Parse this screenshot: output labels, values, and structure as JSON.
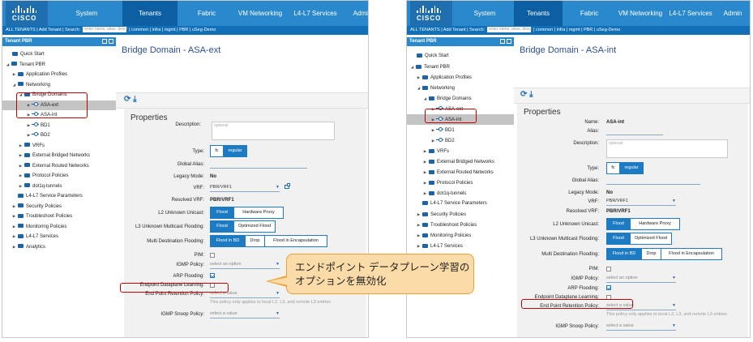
{
  "nav": {
    "logo_text": "CISCO",
    "tabs": [
      "System",
      "Tenants",
      "Fabric",
      "VM Networking",
      "L4-L7 Services",
      "Admin"
    ],
    "active_tab": "Tenants"
  },
  "subnav": {
    "all_tenants": "ALL TENANTS",
    "add_tenant": "Add Tenant",
    "search_label": "Search:",
    "search_placeholder": "enter name, alias, descr",
    "links": [
      "common",
      "infra",
      "mgmt",
      "PBR",
      "uSeg-Demo"
    ]
  },
  "sidebar": {
    "header": "Tenant PBR",
    "items": {
      "quick_start": "Quick Start",
      "tenant": "Tenant PBR",
      "app_profiles": "Application Profiles",
      "networking": "Networking",
      "bridge_domains": "Bridge Domains",
      "asa_ext": "ASA-ext",
      "asa_int": "ASA-int",
      "bd1": "BD1",
      "bd2": "BD2",
      "vrfs": "VRFs",
      "ext_bridged": "External Bridged Networks",
      "ext_routed": "External Routed Networks",
      "protocol_policies": "Protocol Policies",
      "dot1q": "dot1q-tunnels",
      "l4l7_params": "L4-L7 Service Parameters",
      "security_policies": "Security Policies",
      "troubleshoot": "Troubleshoot Policies",
      "monitoring": "Monitoring Policies",
      "l4l7_services": "L4-L7 Services",
      "analytics": "Analytics"
    }
  },
  "left_page": {
    "title": "Bridge Domain - ASA-ext",
    "properties_title": "Properties",
    "fields": {
      "description_label": "Description:",
      "description_placeholder": "optional",
      "type_label": "Type:",
      "type_options": [
        "fc",
        "regular"
      ],
      "global_alias_label": "Global Alias:",
      "legacy_mode_label": "Legacy Mode:",
      "legacy_mode_value": "No",
      "vrf_label": "VRF:",
      "vrf_value": "PBR/VRF1",
      "resolved_vrf_label": "Resolved VRF:",
      "resolved_vrf_value": "PBR/VRF1",
      "l2_unknown_label": "L2 Unknown Unicast:",
      "l2_unknown_options": [
        "Flood",
        "Hardware Proxy"
      ],
      "l3_unknown_label": "L3 Unknown Multicast Flooding:",
      "l3_unknown_options": [
        "Flood",
        "Optimized Flood"
      ],
      "multi_dest_label": "Multi Destination Flooding:",
      "multi_dest_options": [
        "Flood in BD",
        "Drop",
        "Flood in Encapsulation"
      ],
      "pim_label": "PIM:",
      "igmp_policy_label": "IGMP Policy:",
      "igmp_policy_placeholder": "select an option",
      "arp_label": "ARP Flooding:",
      "ep_dataplane_label": "Endpoint Dataplane Learning:",
      "ep_retention_label": "End Point Retention Policy:",
      "ep_retention_placeholder": "select a value",
      "ep_retention_note": "This policy only applies to local L2, L3, and remote L3 entries",
      "igmp_snoop_label": "IGMP Snoop Policy:",
      "igmp_snoop_placeholder": "select a value"
    }
  },
  "right_page": {
    "title": "Bridge Domain - ASA-int",
    "properties_title": "Properties",
    "fields": {
      "name_label": "Name:",
      "name_value": "ASA-int",
      "alias_label": "Alias:",
      "description_label": "Description:",
      "description_placeholder": "optional",
      "type_label": "Type:",
      "type_options": [
        "fc",
        "regular"
      ],
      "global_alias_label": "Global Alias:",
      "legacy_mode_label": "Legacy Mode:",
      "legacy_mode_value": "No",
      "vrf_label": "VRF:",
      "vrf_value": "PBR/VRF1",
      "resolved_vrf_label": "Resolved VRF:",
      "resolved_vrf_value": "PBR/VRF1",
      "l2_unknown_label": "L2 Unknown Unicast:",
      "l2_unknown_options": [
        "Flood",
        "Hardware Proxy"
      ],
      "l3_unknown_label": "L3 Unknown Multicast Flooding:",
      "l3_unknown_options": [
        "Flood",
        "Optimized Flood"
      ],
      "multi_dest_label": "Multi Destination Flooding:",
      "multi_dest_options": [
        "Flood in BD",
        "Drop",
        "Flood in Encapsulation"
      ],
      "pim_label": "PIM:",
      "igmp_policy_label": "IGMP Policy:",
      "igmp_policy_placeholder": "select an option",
      "arp_label": "ARP Flooding:",
      "ep_dataplane_label": "Endpoint Dataplane Learning:",
      "ep_retention_label": "End Point Retention Policy:",
      "ep_retention_placeholder": "select a value",
      "ep_retention_note": "This policy only applies to local L2, L3, and remote L3 entries",
      "igmp_snoop_label": "IGMP Snoop Policy:",
      "igmp_snoop_placeholder": "select a value"
    }
  },
  "callout": {
    "line1": "エンドポイント データプレーン学習の",
    "line2": "オプションを無効化"
  },
  "colors": {
    "nav_blue": "#2a89cc",
    "active_tab": "#0c5fa3",
    "highlight_red": "#c00000",
    "callout_fill": "#fbdba7",
    "callout_border": "#f0a030"
  }
}
